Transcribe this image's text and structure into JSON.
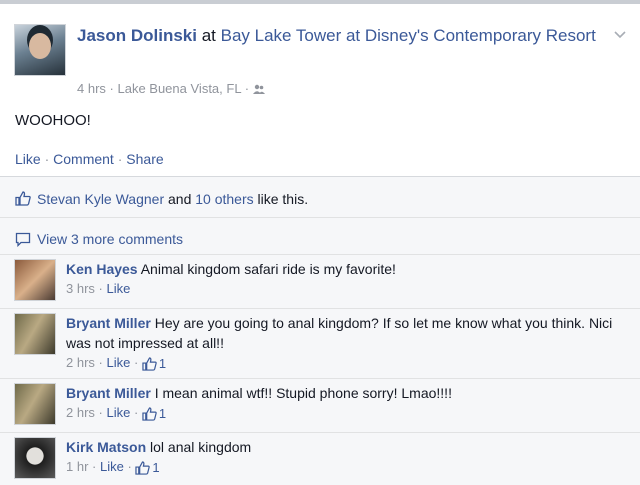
{
  "post": {
    "author": "Jason Dolinski",
    "connector": " at ",
    "place": "Bay Lake Tower at Disney's Contemporary Resort",
    "time": "4 hrs",
    "location": "Lake Buena Vista, FL",
    "text": "WOOHOO!",
    "actions": {
      "like": "Like",
      "comment": "Comment",
      "share": "Share"
    }
  },
  "likes": {
    "name": "Stevan Kyle Wagner",
    "and": " and ",
    "others": "10 others",
    "suffix": " like this."
  },
  "more_comments": "View 3 more comments",
  "comments": [
    {
      "author": "Ken Hayes",
      "text": "Animal kingdom safari ride is my favorite!",
      "time": "3 hrs",
      "like": "Like",
      "count": ""
    },
    {
      "author": "Bryant Miller",
      "text": "Hey are you going to anal kingdom? If so let me know what you think. Nici was not impressed at all!!",
      "time": "2 hrs",
      "like": "Like",
      "count": "1"
    },
    {
      "author": "Bryant Miller",
      "text": "I mean animal wtf!! Stupid phone sorry! Lmao!!!!",
      "time": "2 hrs",
      "like": "Like",
      "count": "1"
    },
    {
      "author": "Kirk Matson",
      "text": "lol anal kingdom",
      "time": "1 hr",
      "like": "Like",
      "count": "1"
    }
  ],
  "icons": {
    "chevron": "chevron-down-icon",
    "audience": "friends-audience-icon",
    "thumb": "thumbs-up-icon",
    "bubble": "comment-bubble-icon"
  },
  "colors": {
    "link": "#3b5998",
    "meta": "#90949c"
  }
}
